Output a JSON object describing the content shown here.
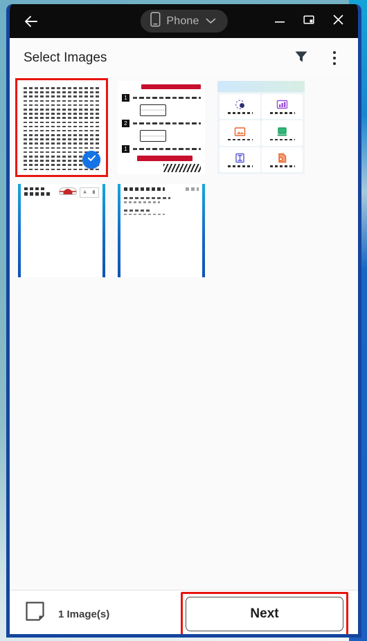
{
  "titlebar": {
    "back_icon": "arrow-left-icon",
    "device_icon": "phone-icon",
    "device_label": "Phone",
    "device_chevron_icon": "chevron-down-icon",
    "minimize_icon": "minimize-icon",
    "restore_icon": "restore-window-icon",
    "close_icon": "close-icon"
  },
  "header": {
    "title": "Select Images",
    "filter_icon": "filter-icon",
    "overflow_icon": "kebab-menu-icon"
  },
  "gallery": {
    "selected_count": 1,
    "items": [
      {
        "id": 1,
        "kind": "text-document",
        "selected": true,
        "badge_icon": "check-circle-icon"
      },
      {
        "id": 2,
        "kind": "instruction-sheet",
        "selected": false
      },
      {
        "id": 3,
        "kind": "app-grid",
        "selected": false
      },
      {
        "id": 4,
        "kind": "scanned-page-rails",
        "selected": false
      },
      {
        "id": 5,
        "kind": "scanned-page-text",
        "selected": false
      }
    ],
    "thumb2": {
      "steps": [
        "1",
        "2",
        "1"
      ]
    },
    "thumb3": {
      "tiles": [
        "gear-sync-icon",
        "chart-icon",
        "image-icon",
        "laptop-icon",
        "frame-icon",
        "file-export-icon"
      ]
    }
  },
  "bottombar": {
    "page_icon": "document-page-icon",
    "count_label": "1 Image(s)",
    "next_label": "Next"
  },
  "colors": {
    "accent_red": "#e8150f",
    "accent_blue": "#1473e6",
    "frame_blue": "#14459e",
    "titlebar_bg": "#0c0c0c"
  }
}
